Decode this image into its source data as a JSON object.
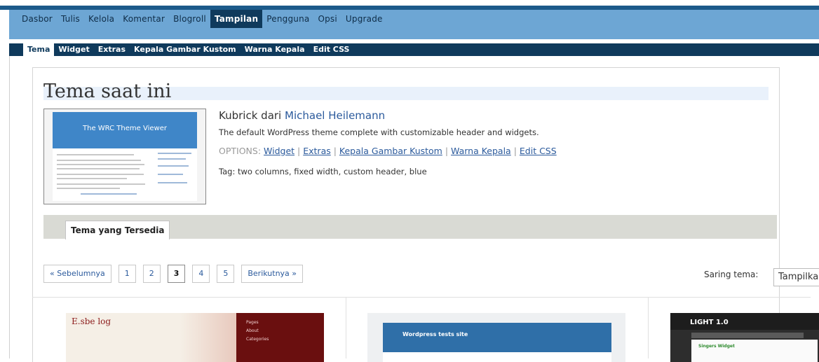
{
  "admin_nav": {
    "items": [
      "Dasbor",
      "Tulis",
      "Kelola",
      "Komentar",
      "Blogroll",
      "Tampilan",
      "Pengguna",
      "Opsi",
      "Upgrade"
    ],
    "active": "Tampilan"
  },
  "sub_nav": {
    "items": [
      "Tema",
      "Widget",
      "Extras",
      "Kepala Gambar Kustom",
      "Warna Kepala",
      "Edit CSS"
    ],
    "active": "Tema"
  },
  "current_theme": {
    "heading": "Tema saat ini",
    "screenshot_title": "The WRC Theme Viewer",
    "name": "Kubrick",
    "by": "dari",
    "author": "Michael Heilemann",
    "description": "The default WordPress theme complete with customizable header and widgets.",
    "options_label": "OPTIONS:",
    "options": [
      "Widget",
      "Extras",
      "Kepala Gambar Kustom",
      "Warna Kepala",
      "Edit CSS"
    ],
    "tags": "Tag: two columns, fixed width, custom header, blue"
  },
  "available": {
    "tab_label": "Tema yang Tersedia"
  },
  "pagination": {
    "prev": "« Sebelumnya",
    "pages": [
      "1",
      "2",
      "3",
      "4",
      "5"
    ],
    "current": "3",
    "next": "Berikutnya »"
  },
  "filter": {
    "label": "Saring tema:",
    "value": "Tampilkan"
  },
  "thumbnails": [
    {
      "title": "E.sbe log",
      "sidebar": [
        "Pages",
        "About",
        "Categories"
      ]
    },
    {
      "title": "Wordpress tests site"
    },
    {
      "title": "LIGHT 1.0",
      "sub": "Singers Widget"
    }
  ],
  "colors": {
    "admin_bar": "#6da6d4",
    "sub_bar": "#0f3a5c",
    "link": "#2b5a9c",
    "title_highlight": "#e9f1fb",
    "available_bar": "#d9dad4"
  }
}
